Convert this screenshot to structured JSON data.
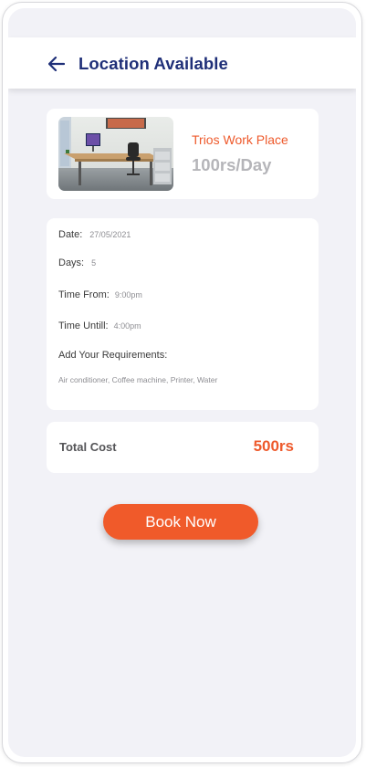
{
  "header": {
    "title": "Location Available",
    "back_icon": "back-arrow-icon"
  },
  "place": {
    "name": "Trios Work Place",
    "price": "100rs/Day",
    "image": "office-desk-photo"
  },
  "details": {
    "date_label": "Date:",
    "date_value": "27/05/2021",
    "days_label": "Days:",
    "days_value": "5",
    "time_from_label": "Time From:",
    "time_from_value": "9:00pm",
    "time_until_label": "Time Untill:",
    "time_until_value": "4:00pm",
    "requirements_label": "Add Your Requirements:",
    "requirements_value": "Air conditioner, Coffee machine,  Printer, Water"
  },
  "total": {
    "label": "Total Cost",
    "value": "500rs"
  },
  "actions": {
    "book_label": "Book Now"
  },
  "colors": {
    "accent": "#f05a2a",
    "title_blue": "#1f2f78",
    "background": "#f2f2f7"
  }
}
